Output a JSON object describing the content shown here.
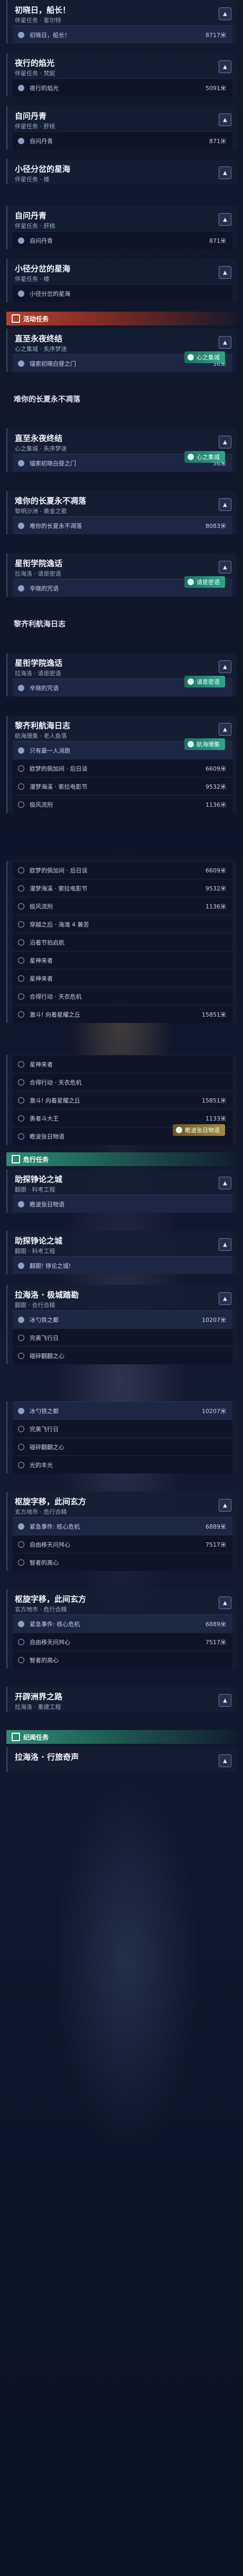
{
  "categories": {
    "activity": "活动任务",
    "danger": "危行任务",
    "legend": "纪闻任务"
  },
  "top_tag": "",
  "sections": [
    {
      "title": "初晓日，船长！",
      "sub": "伴星任务 · 客尔特",
      "active": false,
      "steps": [
        {
          "label": "初晓日，船长！",
          "dist": "8717米"
        }
      ]
    },
    {
      "title": "夜行的焰光",
      "sub": "伴星任务 · 梵妮",
      "active": false,
      "steps": [
        {
          "label": "夜行的焰光",
          "dist": "5091米"
        }
      ]
    },
    {
      "title": "自问丹青",
      "sub": "伴星任务 · 肝桃",
      "active": false,
      "steps": [
        {
          "label": "自问丹青",
          "dist": "871米"
        }
      ]
    },
    {
      "title": "小径分岔的星海",
      "sub": "伴星任务 · 楼",
      "active": false,
      "steps": []
    },
    {
      "title": "自问丹青",
      "sub": "伴星任务 · 肝桃",
      "active": false,
      "steps": [
        {
          "label": "自问丹青",
          "dist": "871米"
        }
      ]
    },
    {
      "title": "小径分岔的星海",
      "sub": "伴星任务 · 楼",
      "active": false,
      "steps": [
        {
          "label": "小径分岔的星海",
          "dist": ""
        }
      ]
    }
  ],
  "activity_sections": [
    {
      "title": "直至永夜终结",
      "sub": "心之集城 · 失序梦迷",
      "tag": "心之集城",
      "steps": [
        {
          "label": "锚索初晓白昼之门",
          "dist": "36米"
        }
      ]
    },
    {
      "title": "难你的长夏永不凋落",
      "sub": "",
      "fade": true
    },
    {
      "title": "直至永夜终结",
      "sub": "心之集城 · 失序梦迷",
      "tag": "心之集城",
      "steps": [
        {
          "label": "锚索初晓白昼之门",
          "dist": "36米"
        }
      ]
    },
    {
      "title": "难你的长夏永不凋落",
      "sub": "黎明沙洲 · 黄金之歌",
      "steps": [
        {
          "label": "难你的长夏永不凋落",
          "dist": "8083米"
        }
      ]
    },
    {
      "title": "星衔学院逸话",
      "sub": "拉海洛 · 请是密语",
      "tag": "请是密语",
      "steps": [
        {
          "label": "辛晓的咒语",
          "dist": ""
        }
      ]
    },
    {
      "title": "黎齐利航海日志",
      "sub": "",
      "fade": true
    },
    {
      "title": "星衔学院逸话",
      "sub": "拉海洛 · 请是密语",
      "tag": "请是密语",
      "steps": [
        {
          "label": "辛晓的咒语",
          "dist": ""
        }
      ]
    },
    {
      "title": "黎齐利航海日志",
      "sub": "航海珊集 · 老人鱼落",
      "tag": "航海珊集",
      "steps": [
        {
          "label": "只有最一人消跑",
          "dist": ""
        },
        {
          "label": "欧梦的佩加间 · 后日谈",
          "dist": "6609米"
        },
        {
          "label": "漫梦海溪 · 索拉电影节",
          "dist": "9532米"
        },
        {
          "label": "极风流刑",
          "dist": "1136米"
        }
      ]
    }
  ],
  "list_block": {
    "steps": [
      {
        "label": "欧梦的佩加间 · 后日谈",
        "dist": "6609米"
      },
      {
        "label": "漫梦海溪 · 索拉电影节",
        "dist": "9532米"
      },
      {
        "label": "极风流刑",
        "dist": "1136米"
      },
      {
        "label": "穿越之后 · 海滩 4 兼苦",
        "dist": ""
      },
      {
        "label": "沿着节拍启航",
        "dist": ""
      },
      {
        "label": "星神来者",
        "dist": ""
      },
      {
        "label": "星神来者",
        "dist": ""
      },
      {
        "label": "合得行动 · 天衣危机",
        "dist": ""
      },
      {
        "label": "激斗! 向着星耀之丘",
        "dist": "15851米"
      }
    ]
  },
  "list_block2": {
    "steps": [
      {
        "label": "星神来者",
        "dist": ""
      },
      {
        "label": "合得行动 · 天衣危机",
        "dist": ""
      },
      {
        "label": "激斗! 向着星耀之丘",
        "dist": "15851米"
      },
      {
        "label": "勇者斗大王",
        "dist": "1133米"
      },
      {
        "label": "瞻波张日物语",
        "dist": ""
      }
    ],
    "tag": "瞻波张日物语"
  },
  "danger_sections": [
    {
      "title": "助探铮论之城",
      "sub": "翻跟 · 科考工程",
      "steps": [
        {
          "label": "瞻波张日物语",
          "dist": ""
        }
      ]
    },
    {
      "title": "助探铮论之城",
      "sub": "翻跟 · 科考工程",
      "steps": [
        {
          "label": "翻跟! 铮论之城!",
          "dist": ""
        }
      ]
    },
    {
      "title": "拉海洛 · 极城踏勘",
      "sub": "翻跟 · 合行合精",
      "steps": [
        {
          "label": "冰勺铁之都",
          "dist": "10207米"
        },
        {
          "label": "完美飞行日",
          "dist": ""
        },
        {
          "label": "碰碎翻翻之心",
          "dist": ""
        }
      ]
    },
    {
      "title": "",
      "sub": "",
      "steps": [
        {
          "label": "冰勺铁之都",
          "dist": "10207米"
        },
        {
          "label": "完美飞行日",
          "dist": ""
        },
        {
          "label": "碰碎翻翻之心",
          "dist": ""
        },
        {
          "label": "光的丰光",
          "dist": ""
        }
      ]
    },
    {
      "title": "枢旋字移，此间玄方",
      "sub": "玄方地市 · 危行合精",
      "steps": [
        {
          "label": "紧急事件: 核心危机",
          "dist": "6889米"
        },
        {
          "label": "自由移天问舛心",
          "dist": "7517米"
        },
        {
          "label": "智者的高心",
          "dist": ""
        }
      ]
    },
    {
      "title": "枢旋字移，此间玄方",
      "sub": "玄方地市 · 危行合精",
      "steps": [
        {
          "label": "紧急事件: 核心危机",
          "dist": "6889米"
        },
        {
          "label": "自由移天问舛心",
          "dist": "7517米"
        },
        {
          "label": "智者的高心",
          "dist": ""
        }
      ]
    },
    {
      "title": "开辟洲界之路",
      "sub": "拉海洛 · 重建工程",
      "steps": []
    }
  ],
  "legend_sections": [
    {
      "title": "拉海洛 · 行旅奇声",
      "sub": "",
      "steps": []
    }
  ]
}
